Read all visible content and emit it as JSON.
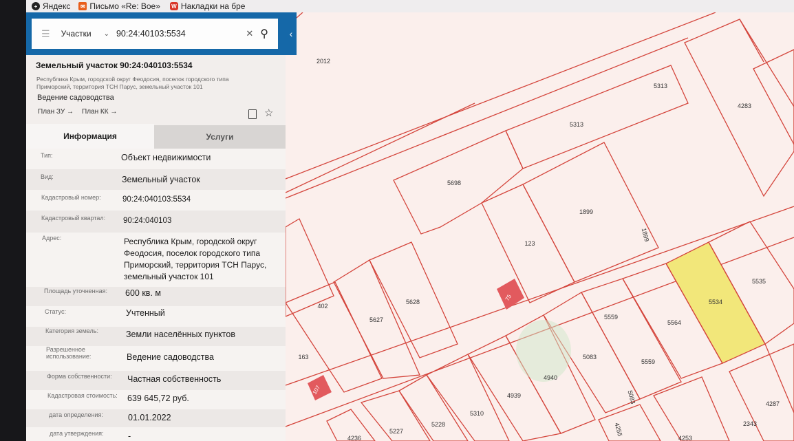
{
  "bookmarks": [
    {
      "label": "Яндекс",
      "icon": "yandex-icon",
      "color": "#222222"
    },
    {
      "label": "Письмо «Re: Вое»",
      "icon": "mail-icon",
      "color": "#e85d1b"
    },
    {
      "label": "Накладки на бре",
      "icon": "store-icon",
      "color": "#d9362a"
    }
  ],
  "search": {
    "menu_icon": "menu-icon",
    "category": "Участки",
    "query": "90:24:40103:5534",
    "clear_icon": "close-icon",
    "search_icon": "search-icon"
  },
  "collapse_icon": "chevron-left-icon",
  "parcel": {
    "title": "Земельный участок 90:24:040103:5534",
    "address_short": "Республика Крым, городской округ Феодосия, поселок городского типа Приморский, территория ТСН Парус, земельный участок 101",
    "use": "Ведение садоводства",
    "links": [
      "План ЗУ →",
      "План КК →"
    ]
  },
  "tabs": [
    {
      "label": "Информация",
      "active": true
    },
    {
      "label": "Услуги",
      "active": false
    }
  ],
  "info": [
    {
      "label": "Тип:",
      "value": "Объект недвижимости"
    },
    {
      "label": "Вид:",
      "value": "Земельный участок"
    },
    {
      "label": "Кадастровый номер:",
      "value": "90:24:040103:5534"
    },
    {
      "label": "Кадастровый квартал:",
      "value": "90:24:040103"
    },
    {
      "label": "Адрес:",
      "value": "Республика Крым, городской округ Феодосия, поселок городского типа Приморский, территория ТСН Парус, земельный участок 101"
    },
    {
      "label": "Площадь уточненная:",
      "value": "600 кв. м"
    },
    {
      "label": "Статус:",
      "value": "Учтенный"
    },
    {
      "label": "Категория земель:",
      "value": "Земли населённых пунктов"
    },
    {
      "label": "Разрешенное использование:",
      "value": "Ведение садоводства"
    },
    {
      "label": "Форма собственности:",
      "value": "Частная собственность"
    },
    {
      "label": "Кадастровая стоимость:",
      "value": "639 645,72 руб."
    },
    {
      "label": "дата определения:",
      "value": "01.01.2022"
    },
    {
      "label": "дата утверждения:",
      "value": "-"
    }
  ],
  "map": {
    "line_color": "#d4453c",
    "highlight_color": "#f2e77a",
    "building_color": "#e25a5e",
    "plot_labels": [
      "2012",
      "5313",
      "5313",
      "4283",
      "5698",
      "1899",
      "1899",
      "123",
      "5535",
      "5534",
      "5564",
      "5559",
      "5559",
      "5083",
      "5083",
      "4940",
      "4939",
      "5627",
      "5628",
      "402",
      "163",
      "5310",
      "5228",
      "5227",
      "4236",
      "4287",
      "2343",
      "4253",
      "4255"
    ],
    "building_labels": [
      "75",
      "107"
    ]
  }
}
